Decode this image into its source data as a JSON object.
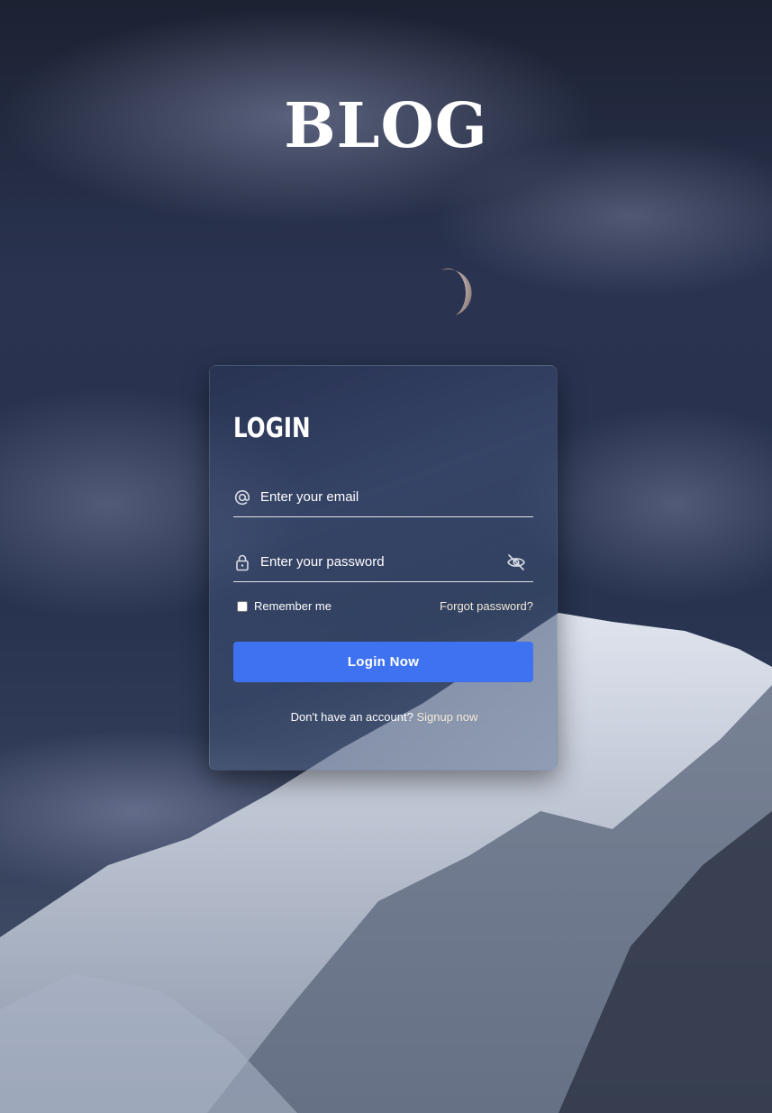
{
  "site": {
    "title": "BLOG"
  },
  "login": {
    "title": "LOGIN",
    "email_placeholder": "Enter your email",
    "password_placeholder": "Enter your password",
    "remember_label": "Remember me",
    "forgot_label": "Forgot password?",
    "submit_label": "Login Now",
    "signup_prompt": "Don't have an account?",
    "signup_link": "Signup now"
  },
  "icons": {
    "email": "at-icon",
    "password": "lock-icon",
    "toggle": "eye-off-icon"
  },
  "colors": {
    "button": "#3f72f0",
    "link": "#f3e9d8"
  }
}
